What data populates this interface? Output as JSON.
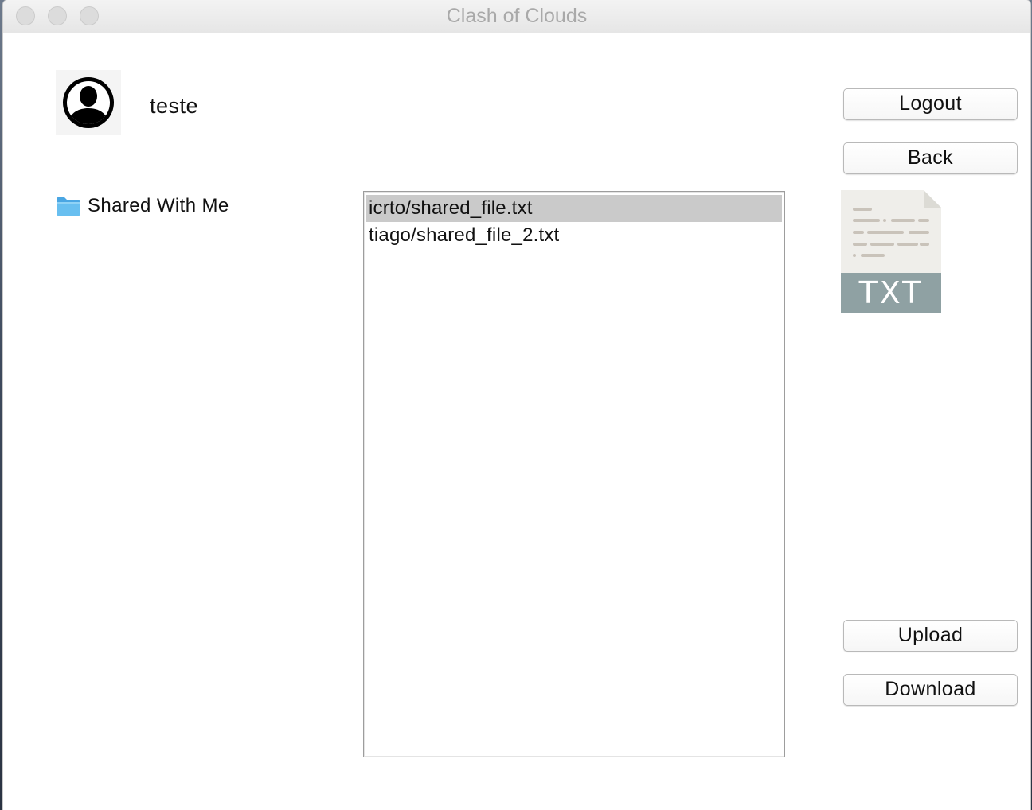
{
  "window": {
    "title": "Clash of Clouds"
  },
  "user": {
    "name": "teste",
    "avatar_icon": "user-circle-icon"
  },
  "sidebar": {
    "folder_label": "Shared With Me",
    "folder_icon": "folder-icon"
  },
  "files": {
    "items": [
      {
        "name": "icrto/shared_file.txt",
        "selected": true
      },
      {
        "name": "tiago/shared_file_2.txt",
        "selected": false
      }
    ]
  },
  "actions": {
    "logout_label": "Logout",
    "back_label": "Back",
    "upload_label": "Upload",
    "download_label": "Download"
  },
  "preview": {
    "file_type_label": "TXT",
    "icon": "txt-file-icon"
  },
  "colors": {
    "selection": "#cacaca",
    "folder_blue": "#5ab4ec",
    "txt_band": "#8fa1a3",
    "doc_page": "#efeeea"
  }
}
